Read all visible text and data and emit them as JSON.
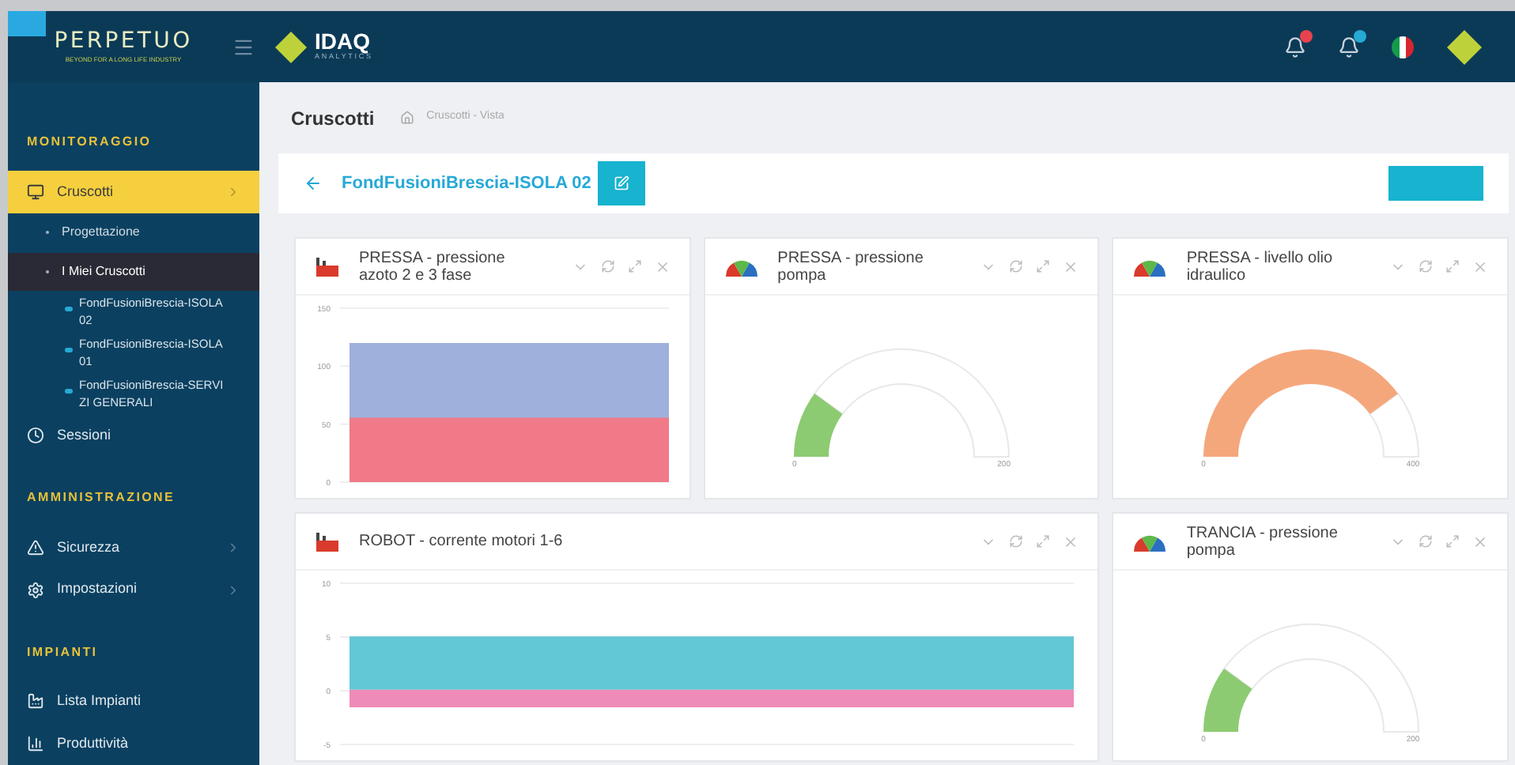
{
  "header": {
    "brand": "PERPETUO",
    "brand_tagline": "BEYOND FOR A LONG LIFE INDUSTRY",
    "product": "IDAQ",
    "product_tagline": "ANALYTICS",
    "notifications": [
      {
        "color": "#e8424f"
      },
      {
        "color": "#27a9d6"
      }
    ]
  },
  "sidebar": {
    "items": [
      {
        "kind": "section",
        "label": "MONITORAGGIO"
      },
      {
        "kind": "item",
        "label": "Cruscotti",
        "selected": true,
        "has_submenu": true
      },
      {
        "kind": "subitem",
        "label": "Progettazione",
        "selected": false
      },
      {
        "kind": "subitem",
        "label": "I Miei Cruscotti",
        "selected": true
      },
      {
        "kind": "dashboard",
        "label": "FondFusioniBrescia-ISOLA 02"
      },
      {
        "kind": "dashboard",
        "label": "FondFusioniBrescia-ISOLA 01"
      },
      {
        "kind": "dashboard",
        "label": "FondFusioniBrescia-SERVIZI GENERALI"
      },
      {
        "kind": "item",
        "label": "Sessioni",
        "selected": false,
        "has_submenu": false
      },
      {
        "kind": "section",
        "label": "AMMINISTRAZIONE"
      },
      {
        "kind": "item",
        "label": "Sicurezza",
        "selected": false,
        "has_submenu": true
      },
      {
        "kind": "item",
        "label": "Impostazioni",
        "selected": false,
        "has_submenu": true
      },
      {
        "kind": "section",
        "label": "IMPIANTI"
      },
      {
        "kind": "item",
        "label": "Lista Impianti",
        "selected": false,
        "has_submenu": false
      },
      {
        "kind": "item",
        "label": "Produttività",
        "selected": false,
        "has_submenu": false
      }
    ]
  },
  "page": {
    "title": "Cruscotti",
    "breadcrumb": "Cruscotti - Vista"
  },
  "dashboard": {
    "title": "FondFusioniBrescia-ISOLA 02",
    "rows": [
      [
        {
          "kind": "area",
          "title": "PRESSA - pressione azoto 2 e 3 fase",
          "axis_labels": [
            "150",
            "100",
            "50",
            "0"
          ],
          "areas": [
            {
              "color": "#9fb0dc"
            },
            {
              "color": "#f07a88"
            }
          ]
        },
        {
          "kind": "gauge",
          "title": "PRESSA - pressione pompa",
          "color": "#8dcb72",
          "min_label": "0",
          "max_label": "200"
        },
        {
          "kind": "gauge",
          "title": "PRESSA - livello olio idraulico",
          "color": "#f5a77c",
          "min_label": "0",
          "max_label": "400"
        }
      ],
      [
        {
          "kind": "area",
          "colspan": 2,
          "title": "ROBOT - corrente motori 1-6",
          "axis_labels": [
            "10",
            "5",
            "0",
            "-5"
          ],
          "areas": [
            {
              "color": "#62c8d6"
            },
            {
              "color": "#ee8bb8"
            }
          ]
        },
        {
          "kind": "gauge",
          "title": "TRANCIA - pressione pompa",
          "color": "#8dcb72",
          "min_label": "0",
          "max_label": "200"
        }
      ]
    ]
  }
}
